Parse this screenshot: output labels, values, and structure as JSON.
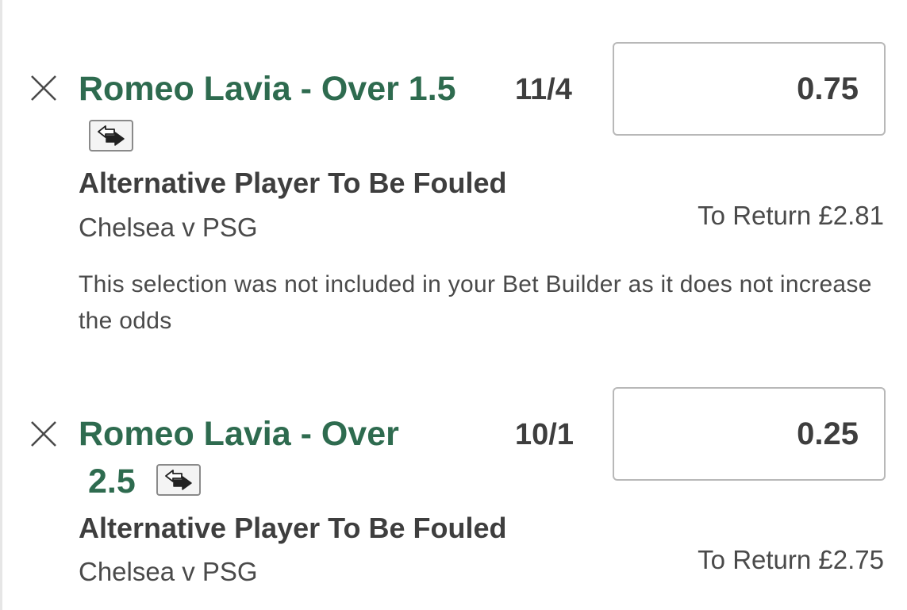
{
  "bets": [
    {
      "title": "Romeo Lavia - Over 1.5",
      "odds": "11/4",
      "stake": "0.75",
      "market": "Alternative Player To Be Fouled",
      "event": "Chelsea v PSG",
      "to_return": "To Return £2.81",
      "note": "This selection was not included in your Bet Builder as it does not increase the odds"
    },
    {
      "title_line1": "Romeo Lavia - Over",
      "title_line2": "2.5",
      "odds": "10/1",
      "stake": "0.25",
      "market": "Alternative Player To Be Fouled",
      "event": "Chelsea v PSG",
      "to_return": "To Return £2.75"
    }
  ],
  "icons": {
    "remove": "close-icon",
    "swap": "swap-arrows-icon"
  },
  "colors": {
    "selection_green": "#2e6b4f",
    "text_dark": "#3e3e3e",
    "border_grey": "#b8b8b8"
  }
}
